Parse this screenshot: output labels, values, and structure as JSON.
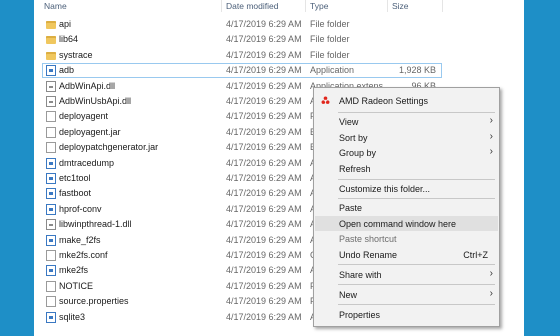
{
  "columns": {
    "name": "Name",
    "date": "Date modified",
    "type": "Type",
    "size": "Size"
  },
  "files": [
    {
      "name": "api",
      "date": "4/17/2019 6:29 AM",
      "type": "File folder",
      "size": "",
      "icon": "folder-icon"
    },
    {
      "name": "lib64",
      "date": "4/17/2019 6:29 AM",
      "type": "File folder",
      "size": "",
      "icon": "folder-icon"
    },
    {
      "name": "systrace",
      "date": "4/17/2019 6:29 AM",
      "type": "File folder",
      "size": "",
      "icon": "folder-icon"
    },
    {
      "name": "adb",
      "date": "4/17/2019 6:29 AM",
      "type": "Application",
      "size": "1,928 KB",
      "icon": "application-icon"
    },
    {
      "name": "AdbWinApi.dll",
      "date": "4/17/2019 6:29 AM",
      "type": "Application extens...",
      "size": "96 KB",
      "icon": "dll-icon"
    },
    {
      "name": "AdbWinUsbApi.dll",
      "date": "4/17/2019 6:29 AM",
      "type": "A",
      "size": "",
      "icon": "dll-icon"
    },
    {
      "name": "deployagent",
      "date": "4/17/2019 6:29 AM",
      "type": "F",
      "size": "",
      "icon": "file-icon"
    },
    {
      "name": "deployagent.jar",
      "date": "4/17/2019 6:29 AM",
      "type": "E",
      "size": "",
      "icon": "file-icon"
    },
    {
      "name": "deploypatchgenerator.jar",
      "date": "4/17/2019 6:29 AM",
      "type": "E",
      "size": "",
      "icon": "file-icon"
    },
    {
      "name": "dmtracedump",
      "date": "4/17/2019 6:29 AM",
      "type": "A",
      "size": "",
      "icon": "application-icon"
    },
    {
      "name": "etc1tool",
      "date": "4/17/2019 6:29 AM",
      "type": "A",
      "size": "",
      "icon": "application-icon"
    },
    {
      "name": "fastboot",
      "date": "4/17/2019 6:29 AM",
      "type": "A",
      "size": "",
      "icon": "application-icon"
    },
    {
      "name": "hprof-conv",
      "date": "4/17/2019 6:29 AM",
      "type": "A",
      "size": "",
      "icon": "application-icon"
    },
    {
      "name": "libwinpthread-1.dll",
      "date": "4/17/2019 6:29 AM",
      "type": "A",
      "size": "",
      "icon": "dll-icon"
    },
    {
      "name": "make_f2fs",
      "date": "4/17/2019 6:29 AM",
      "type": "A",
      "size": "",
      "icon": "application-icon"
    },
    {
      "name": "mke2fs.conf",
      "date": "4/17/2019 6:29 AM",
      "type": "C",
      "size": "",
      "icon": "file-icon"
    },
    {
      "name": "mke2fs",
      "date": "4/17/2019 6:29 AM",
      "type": "A",
      "size": "",
      "icon": "application-icon"
    },
    {
      "name": "NOTICE",
      "date": "4/17/2019 6:29 AM",
      "type": "F",
      "size": "",
      "icon": "file-icon"
    },
    {
      "name": "source.properties",
      "date": "4/17/2019 6:29 AM",
      "type": "F",
      "size": "",
      "icon": "file-icon"
    },
    {
      "name": "sqlite3",
      "date": "4/17/2019 6:29 AM",
      "type": "A",
      "size": "",
      "icon": "application-icon"
    }
  ],
  "selected_file": "adb",
  "context_menu": {
    "amd": "AMD Radeon Settings",
    "view": "View",
    "sort_by": "Sort by",
    "group_by": "Group by",
    "refresh": "Refresh",
    "customize": "Customize this folder...",
    "paste": "Paste",
    "open_cmd": "Open command window here",
    "paste_shortcut": "Paste shortcut",
    "undo_rename": "Undo Rename",
    "undo_shortcut": "Ctrl+Z",
    "share_with": "Share with",
    "new": "New",
    "properties": "Properties"
  },
  "colors": {
    "desktop": "#1e8fc7",
    "menu_bg": "#f2f2f2",
    "highlight": "#e0e0e0",
    "amd_red": "#e1261c"
  }
}
